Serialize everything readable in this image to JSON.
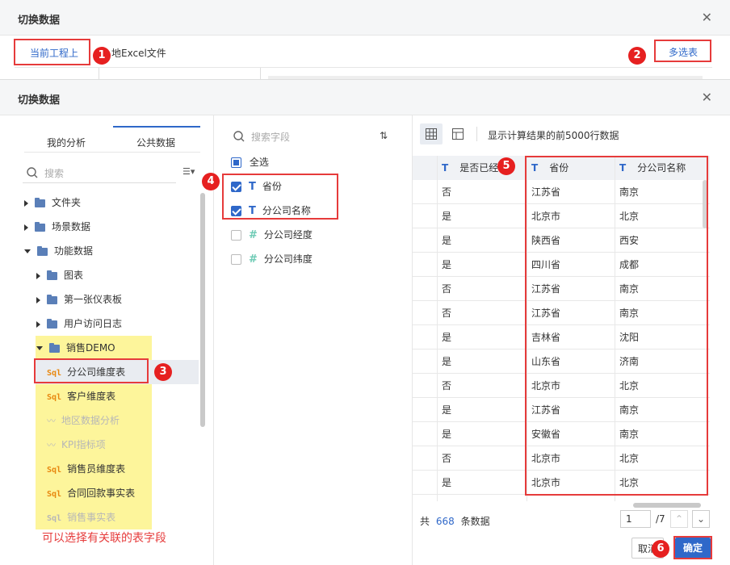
{
  "back_dialog": {
    "title": "切换数据",
    "tab_current_project": "当前工程上",
    "tab_local_excel": "地Excel文件",
    "multi_select_button": "多选表"
  },
  "dialog": {
    "title": "切换数据",
    "tabs": [
      "我的分析",
      "公共数据"
    ],
    "search_placeholder": "搜索",
    "tree": [
      {
        "label": "文件夹",
        "level": 0,
        "kind": "folder",
        "expand": "collapsed"
      },
      {
        "label": "场景数据",
        "level": 0,
        "kind": "folder",
        "expand": "collapsed"
      },
      {
        "label": "功能数据",
        "level": 0,
        "kind": "folder",
        "expand": "expanded"
      },
      {
        "label": "图表",
        "level": 1,
        "kind": "folder",
        "expand": "collapsed"
      },
      {
        "label": "第一张仪表板",
        "level": 1,
        "kind": "folder",
        "expand": "collapsed"
      },
      {
        "label": "用户访问日志",
        "level": 1,
        "kind": "folder",
        "expand": "collapsed"
      },
      {
        "label": "销售DEMO",
        "level": 1,
        "kind": "folder",
        "expand": "expanded"
      },
      {
        "label": "分公司维度表",
        "level": 2,
        "kind": "sql",
        "selected": true
      },
      {
        "label": "客户维度表",
        "level": 2,
        "kind": "sql"
      },
      {
        "label": "地区数据分析",
        "level": 2,
        "kind": "analysis",
        "disabled": true
      },
      {
        "label": "KPI指标项",
        "level": 2,
        "kind": "analysis",
        "disabled": true
      },
      {
        "label": "销售员维度表",
        "level": 2,
        "kind": "sql"
      },
      {
        "label": "合同回款事实表",
        "level": 2,
        "kind": "sql"
      },
      {
        "label": "销售事实表",
        "level": 2,
        "kind": "sql",
        "disabled": true
      }
    ],
    "field_search_placeholder": "搜索字段",
    "select_all": "全选",
    "fields": [
      {
        "name": "省份",
        "type": "T",
        "checked": true
      },
      {
        "name": "分公司名称",
        "type": "T",
        "checked": true
      },
      {
        "name": "分公司经度",
        "type": "#",
        "checked": false
      },
      {
        "name": "分公司纬度",
        "type": "#",
        "checked": false
      }
    ],
    "preview_note": "显示计算结果的前5000行数据",
    "columns": [
      "是否已经",
      "省份",
      "分公司名称"
    ],
    "rows": [
      [
        "否",
        "江苏省",
        "南京"
      ],
      [
        "是",
        "北京市",
        "北京"
      ],
      [
        "是",
        "陕西省",
        "西安"
      ],
      [
        "是",
        "四川省",
        "成都"
      ],
      [
        "否",
        "江苏省",
        "南京"
      ],
      [
        "否",
        "江苏省",
        "南京"
      ],
      [
        "是",
        "吉林省",
        "沈阳"
      ],
      [
        "是",
        "山东省",
        "济南"
      ],
      [
        "否",
        "北京市",
        "北京"
      ],
      [
        "是",
        "江苏省",
        "南京"
      ],
      [
        "是",
        "安徽省",
        "南京"
      ],
      [
        "否",
        "北京市",
        "北京"
      ],
      [
        "是",
        "北京市",
        "北京"
      ]
    ],
    "footer": {
      "prefix": "共",
      "count": "668",
      "suffix": "条数据",
      "page": "1",
      "total_pages": "/7"
    },
    "cancel_button": "取消",
    "confirm_button": "确定"
  },
  "annotations": {
    "badges": [
      "1",
      "2",
      "3",
      "4",
      "5",
      "6"
    ],
    "caption": "可以选择有关联的表字段"
  },
  "colors": {
    "accent": "#2f68c9",
    "annotation_red": "#e63b3b",
    "highlight_yellow": "#fdf59b"
  }
}
